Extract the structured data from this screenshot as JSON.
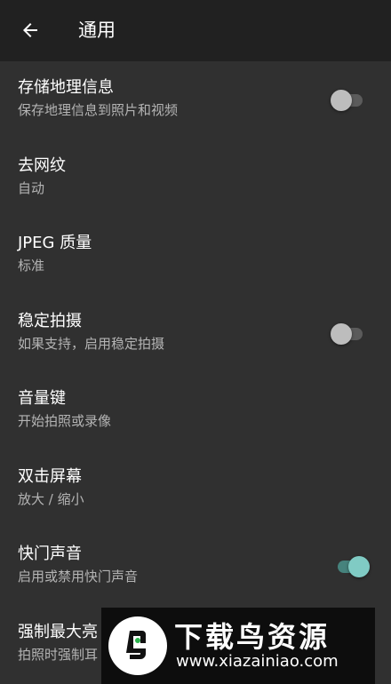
{
  "header": {
    "title": "通用",
    "back_icon": "arrow-left-icon"
  },
  "settings": [
    {
      "title": "存储地理信息",
      "subtitle": "保存地理信息到照片和视频",
      "switch": true,
      "on": false
    },
    {
      "title": "去网纹",
      "subtitle": "自动",
      "switch": false
    },
    {
      "title": "JPEG 质量",
      "subtitle": "标准",
      "switch": false
    },
    {
      "title": "稳定拍摄",
      "subtitle": "如果支持，启用稳定拍摄",
      "switch": true,
      "on": false
    },
    {
      "title": "音量键",
      "subtitle": "开始拍照或录像",
      "switch": false
    },
    {
      "title": "双击屏幕",
      "subtitle": "放大 / 缩小",
      "switch": false
    },
    {
      "title": "快门声音",
      "subtitle": "启用或禁用快门声音",
      "switch": true,
      "on": true
    },
    {
      "title": "强制最大亮",
      "subtitle": "拍照时强制耳",
      "switch": false
    }
  ],
  "watermark": {
    "title": "下载鸟资源",
    "url": "www.xiazainiao.com"
  },
  "colors": {
    "background": "#303030",
    "appbar": "#212121",
    "accent": "#80cbc4"
  }
}
